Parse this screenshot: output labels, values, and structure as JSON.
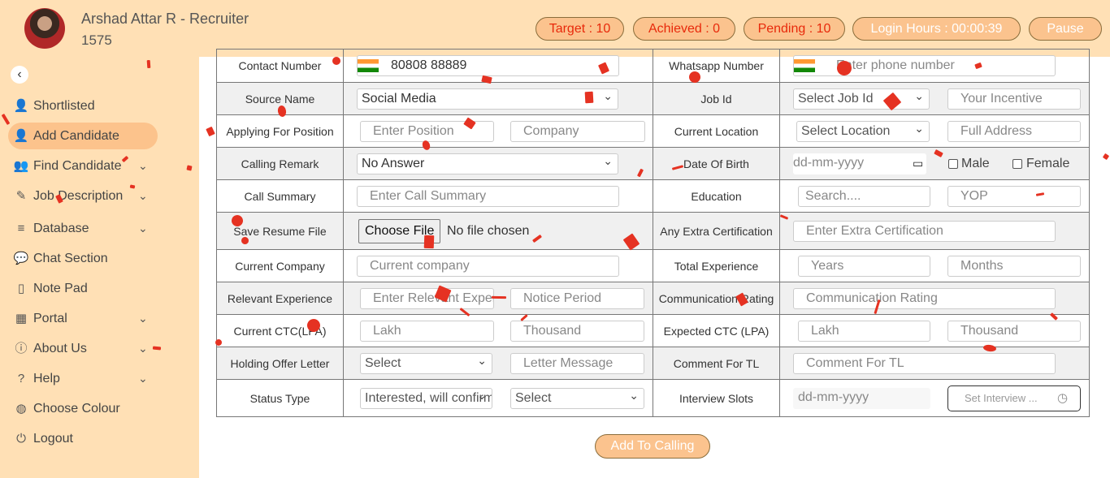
{
  "user": {
    "name": "Arshad Attar R - Recruiter",
    "id": "1575"
  },
  "stats": {
    "target": "Target : 10",
    "achieved": "Achieved : 0",
    "pending": "Pending : 10",
    "login_hours": "Login Hours : 00:00:39",
    "pause": "Pause"
  },
  "sidebar": {
    "back_icon": "chevron-left-icon",
    "items": [
      {
        "label": "Shortlisted",
        "icon": "user-check-icon"
      },
      {
        "label": "Add Candidate",
        "icon": "user-plus-icon",
        "active": true
      },
      {
        "label": "Find Candidate",
        "icon": "users-icon",
        "dropdown": true
      },
      {
        "label": "Job Description",
        "icon": "edit-icon",
        "dropdown": true
      },
      {
        "label": "Database",
        "icon": "database-icon",
        "dropdown": true
      },
      {
        "label": "Chat Section",
        "icon": "chat-icon"
      },
      {
        "label": "Note Pad",
        "icon": "clipboard-icon"
      },
      {
        "label": "Portal",
        "icon": "table-icon",
        "dropdown": true
      },
      {
        "label": "About Us",
        "icon": "info-icon",
        "dropdown": true
      },
      {
        "label": "Help",
        "icon": "question-icon",
        "dropdown": true
      },
      {
        "label": "Choose Colour",
        "icon": "palette-icon"
      },
      {
        "label": "Logout",
        "icon": "power-icon"
      }
    ]
  },
  "form": {
    "contact_number": {
      "label": "Contact Number",
      "value": "80808 88889"
    },
    "whatsapp_number": {
      "label": "Whatsapp Number",
      "placeholder": "Enter phone number"
    },
    "source_name": {
      "label": "Source Name",
      "value": "Social Media"
    },
    "job_id": {
      "label": "Job Id",
      "value": "Select Job Id",
      "incentive_placeholder": "Your Incentive"
    },
    "applying_for_position": {
      "label": "Applying For Position",
      "position_placeholder": "Enter Position",
      "company_placeholder": "Company"
    },
    "current_location": {
      "label": "Current Location",
      "value": "Select Location",
      "address_placeholder": "Full Address"
    },
    "calling_remark": {
      "label": "Calling Remark",
      "value": "No Answer"
    },
    "date_of_birth": {
      "label": "Date Of Birth",
      "placeholder": "dd-mm-yyyy",
      "male": "Male",
      "female": "Female"
    },
    "call_summary": {
      "label": "Call Summary",
      "placeholder": "Enter Call Summary"
    },
    "education": {
      "label": "Education",
      "search_placeholder": "Search....",
      "yop_placeholder": "YOP"
    },
    "save_resume_file": {
      "label": "Save Resume File",
      "button": "Choose File",
      "status": "No file chosen"
    },
    "any_extra_certification": {
      "label": "Any Extra Certification",
      "placeholder": "Enter Extra Certification"
    },
    "current_company": {
      "label": "Current Company",
      "placeholder": "Current company"
    },
    "total_experience": {
      "label": "Total Experience",
      "years_placeholder": "Years",
      "months_placeholder": "Months"
    },
    "relevant_experience": {
      "label": "Relevant Experience",
      "placeholder": "Enter Relevant Experience",
      "notice_placeholder": "Notice Period"
    },
    "communication_rating": {
      "label": "Communication Rating",
      "placeholder": "Communication Rating"
    },
    "current_ctc": {
      "label": "Current CTC(LPA)",
      "lakh_placeholder": "Lakh",
      "thousand_placeholder": "Thousand"
    },
    "expected_ctc": {
      "label": "Expected CTC (LPA)",
      "lakh_placeholder": "Lakh",
      "thousand_placeholder": "Thousand"
    },
    "holding_offer_letter": {
      "label": "Holding Offer Letter",
      "value": "Select",
      "message_placeholder": "Letter Message"
    },
    "comment_for_tl": {
      "label": "Comment For TL",
      "placeholder": "Comment For TL"
    },
    "status_type": {
      "label": "Status Type",
      "value": "Interested, will confirm later",
      "second_value": "Select"
    },
    "interview_slots": {
      "label": "Interview Slots",
      "date_placeholder": "dd-mm-yyyy",
      "time_placeholder": "Set Interview ..."
    }
  },
  "submit_label": "Add To Calling",
  "colors": {
    "accent": "#ffe0b5",
    "button": "#fbc38e",
    "active_nav": "#fcc38c",
    "stat_text": "#e8290b",
    "confetti": "#e53222"
  }
}
